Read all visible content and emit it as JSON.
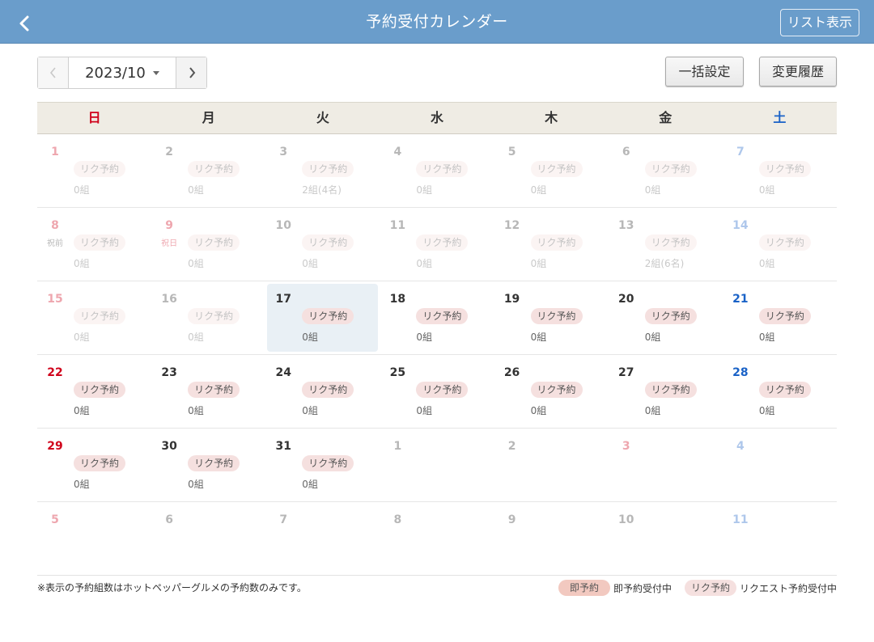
{
  "header": {
    "title": "予約受付カレンダー",
    "list_button": "リスト表示"
  },
  "nav": {
    "month": "2023/10"
  },
  "toolbar": {
    "bulk_label": "一括設定",
    "history_label": "変更履歴"
  },
  "weekdays": [
    "日",
    "月",
    "火",
    "水",
    "木",
    "金",
    "土"
  ],
  "weeks": [
    [
      {
        "day": "1",
        "badge": "リク予約",
        "count": "0組"
      },
      {
        "day": "2",
        "badge": "リク予約",
        "count": "0組"
      },
      {
        "day": "3",
        "badge": "リク予約",
        "count": "2組(4名)"
      },
      {
        "day": "4",
        "badge": "リク予約",
        "count": "0組"
      },
      {
        "day": "5",
        "badge": "リク予約",
        "count": "0組"
      },
      {
        "day": "6",
        "badge": "リク予約",
        "count": "0組"
      },
      {
        "day": "7",
        "badge": "リク予約",
        "count": "0組"
      }
    ],
    [
      {
        "day": "8",
        "note": "祝前",
        "badge": "リク予約",
        "count": "0組"
      },
      {
        "day": "9",
        "note": "祝日",
        "badge": "リク予約",
        "count": "0組"
      },
      {
        "day": "10",
        "badge": "リク予約",
        "count": "0組"
      },
      {
        "day": "11",
        "badge": "リク予約",
        "count": "0組"
      },
      {
        "day": "12",
        "badge": "リク予約",
        "count": "0組"
      },
      {
        "day": "13",
        "badge": "リク予約",
        "count": "2組(6名)"
      },
      {
        "day": "14",
        "badge": "リク予約",
        "count": "0組"
      }
    ],
    [
      {
        "day": "15",
        "badge": "リク予約",
        "count": "0組"
      },
      {
        "day": "16",
        "badge": "リク予約",
        "count": "0組"
      },
      {
        "day": "17",
        "badge": "リク予約",
        "count": "0組"
      },
      {
        "day": "18",
        "badge": "リク予約",
        "count": "0組"
      },
      {
        "day": "19",
        "badge": "リク予約",
        "count": "0組"
      },
      {
        "day": "20",
        "badge": "リク予約",
        "count": "0組"
      },
      {
        "day": "21",
        "badge": "リク予約",
        "count": "0組"
      }
    ],
    [
      {
        "day": "22",
        "badge": "リク予約",
        "count": "0組"
      },
      {
        "day": "23",
        "badge": "リク予約",
        "count": "0組"
      },
      {
        "day": "24",
        "badge": "リク予約",
        "count": "0組"
      },
      {
        "day": "25",
        "badge": "リク予約",
        "count": "0組"
      },
      {
        "day": "26",
        "badge": "リク予約",
        "count": "0組"
      },
      {
        "day": "27",
        "badge": "リク予約",
        "count": "0組"
      },
      {
        "day": "28",
        "badge": "リク予約",
        "count": "0組"
      }
    ],
    [
      {
        "day": "29",
        "badge": "リク予約",
        "count": "0組"
      },
      {
        "day": "30",
        "badge": "リク予約",
        "count": "0組"
      },
      {
        "day": "31",
        "badge": "リク予約",
        "count": "0組"
      },
      {
        "day": "1"
      },
      {
        "day": "2"
      },
      {
        "day": "3"
      },
      {
        "day": "4"
      }
    ],
    [
      {
        "day": "5"
      },
      {
        "day": "6"
      },
      {
        "day": "7"
      },
      {
        "day": "8"
      },
      {
        "day": "9"
      },
      {
        "day": "10"
      },
      {
        "day": "11"
      }
    ]
  ],
  "footer": {
    "note": "※表示の予約組数はホットペッパーグルメの予約数のみです。",
    "legend_immediate_badge": "即予約",
    "legend_immediate_text": "即予約受付中",
    "legend_request_badge": "リク予約",
    "legend_request_text": "リクエスト予約受付中"
  },
  "colors": {
    "header_bg": "#6a9dcb",
    "sunday": "#d0021b",
    "saturday": "#1a62c7",
    "request_badge": "#f5e0df",
    "immediate_badge": "#f2c9c0",
    "today_bg": "#e9f0f5"
  }
}
